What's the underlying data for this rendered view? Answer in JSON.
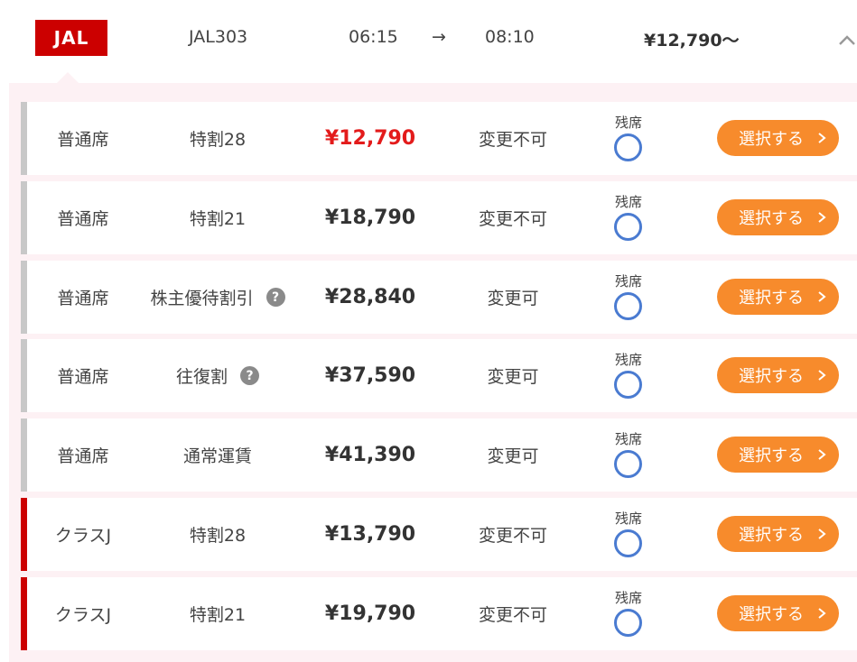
{
  "flight": {
    "airline_logo": "JAL",
    "flight_number": "JAL303",
    "departure": "06:15",
    "arrow": "→",
    "arrival": "08:10",
    "lowest_fare": "¥12,790〜",
    "toggle_icon": "chevron-up-icon"
  },
  "colors": {
    "brand_red": "#cc0000",
    "price_highlight": "#e31b1b",
    "button_orange": "#f78b2c",
    "availability_blue": "#4a7bd1",
    "standard_bar": "#c8c8c8",
    "classj_bar": "#cc0000",
    "panel_bg": "#fdf1f4"
  },
  "fares": [
    {
      "seat_class": "普通席",
      "fare_type": "特割28",
      "has_help": false,
      "price": "¥12,790",
      "highlight": true,
      "change_policy": "変更不可",
      "availability_label": "残席",
      "availability_icon": "circle-available-icon",
      "button_label": "選択する",
      "tier": "standard"
    },
    {
      "seat_class": "普通席",
      "fare_type": "特割21",
      "has_help": false,
      "price": "¥18,790",
      "highlight": false,
      "change_policy": "変更不可",
      "availability_label": "残席",
      "availability_icon": "circle-available-icon",
      "button_label": "選択する",
      "tier": "standard"
    },
    {
      "seat_class": "普通席",
      "fare_type": "株主優待割引",
      "has_help": true,
      "price": "¥28,840",
      "highlight": false,
      "change_policy": "変更可",
      "availability_label": "残席",
      "availability_icon": "circle-available-icon",
      "button_label": "選択する",
      "tier": "standard"
    },
    {
      "seat_class": "普通席",
      "fare_type": "往復割",
      "has_help": true,
      "price": "¥37,590",
      "highlight": false,
      "change_policy": "変更可",
      "availability_label": "残席",
      "availability_icon": "circle-available-icon",
      "button_label": "選択する",
      "tier": "standard"
    },
    {
      "seat_class": "普通席",
      "fare_type": "通常運賃",
      "has_help": false,
      "price": "¥41,390",
      "highlight": false,
      "change_policy": "変更可",
      "availability_label": "残席",
      "availability_icon": "circle-available-icon",
      "button_label": "選択する",
      "tier": "standard"
    },
    {
      "seat_class": "クラスJ",
      "fare_type": "特割28",
      "has_help": false,
      "price": "¥13,790",
      "highlight": false,
      "change_policy": "変更不可",
      "availability_label": "残席",
      "availability_icon": "circle-available-icon",
      "button_label": "選択する",
      "tier": "classj"
    },
    {
      "seat_class": "クラスJ",
      "fare_type": "特割21",
      "has_help": false,
      "price": "¥19,790",
      "highlight": false,
      "change_policy": "変更不可",
      "availability_label": "残席",
      "availability_icon": "circle-available-icon",
      "button_label": "選択する",
      "tier": "classj"
    }
  ]
}
